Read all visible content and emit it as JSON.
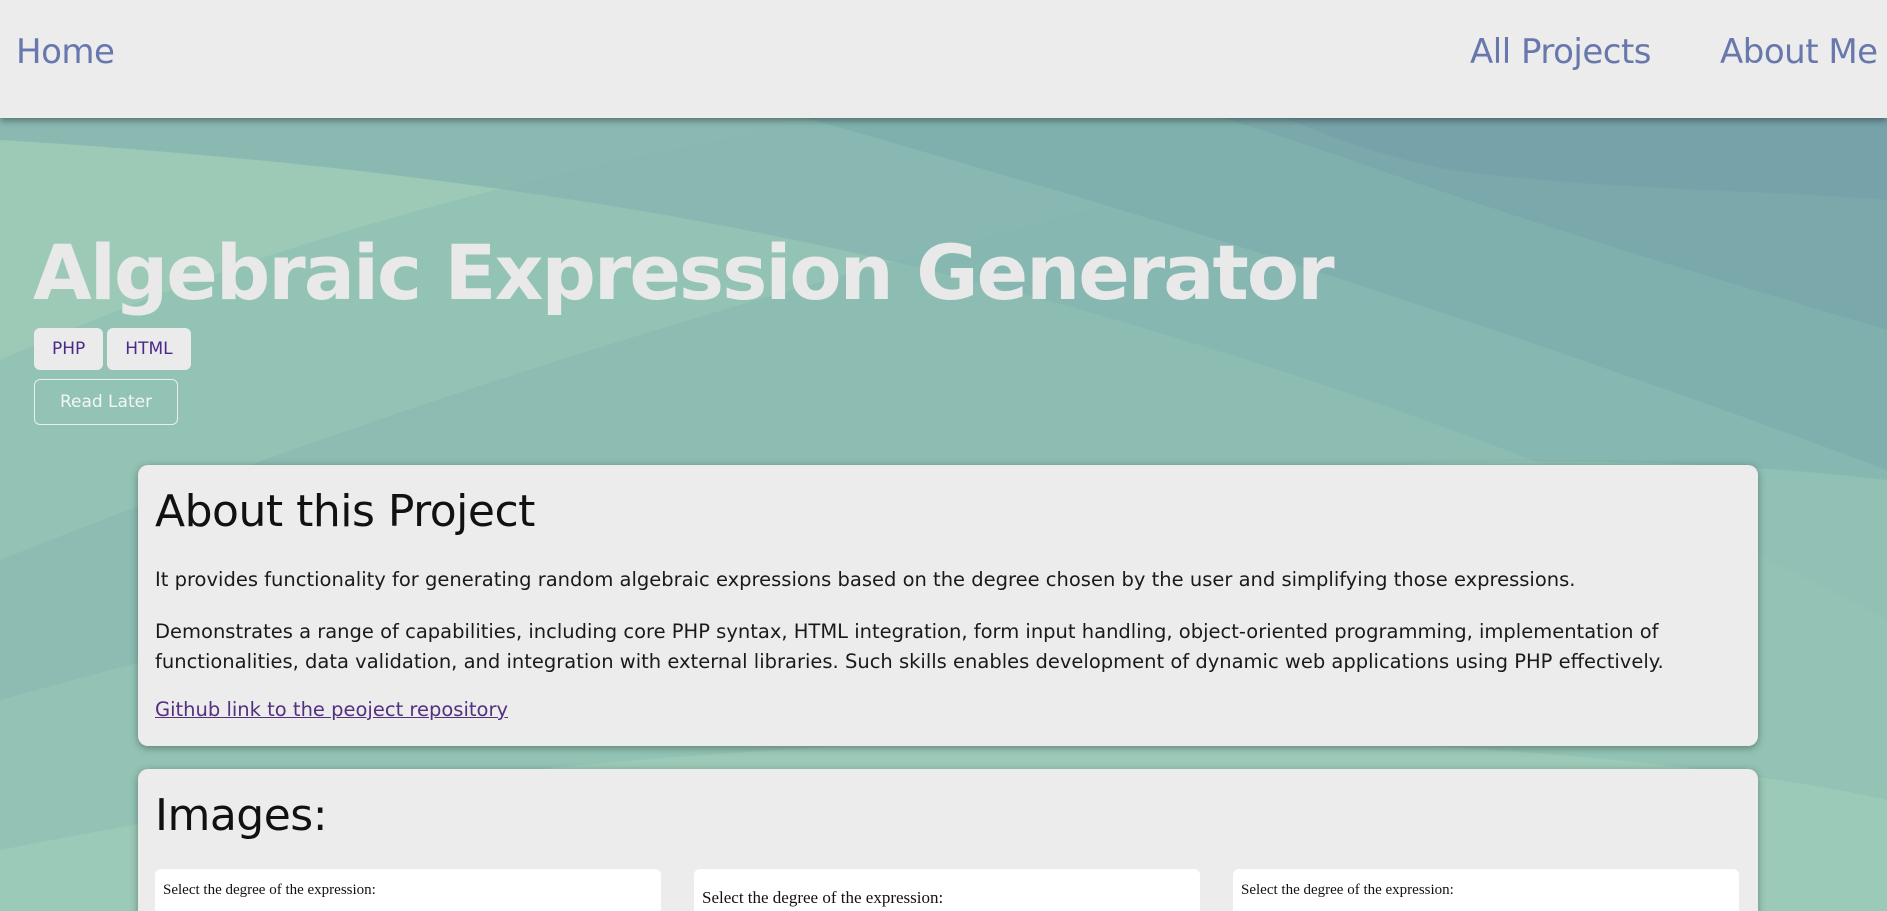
{
  "nav": {
    "home": "Home",
    "all_projects": "All Projects",
    "about_me": "About Me"
  },
  "hero": {
    "title": "Algebraic Expression Generator",
    "tags": [
      "PHP",
      "HTML"
    ],
    "read_later": "Read Later"
  },
  "about": {
    "heading": "About this Project",
    "paragraph_1": "It provides functionality for generating random algebraic expressions based on the degree chosen by the user and simplifying those expressions.",
    "paragraph_2": "Demonstrates a range of capabilities, including core PHP syntax, HTML integration, form input handling, object-oriented programming, implementation of functionalities, data validation, and integration with external libraries. Such skills enables development of dynamic web applications using PHP effectively.",
    "repo_link": "Github link to the peoject repository"
  },
  "images": {
    "heading": "Images:",
    "thumbnails": [
      {
        "caption": "Select the degree of the expression:"
      },
      {
        "caption": "Select the degree of the expression:"
      },
      {
        "caption": "Select the degree of the expression:"
      }
    ]
  },
  "colors": {
    "nav_background": "#ececec",
    "nav_link": "#6878ad",
    "hero_background": "#8fbfb2",
    "hero_title": "#e9e9e9",
    "tag_text": "#4a2a86",
    "card_background": "#ececec",
    "link": "#55307e"
  }
}
